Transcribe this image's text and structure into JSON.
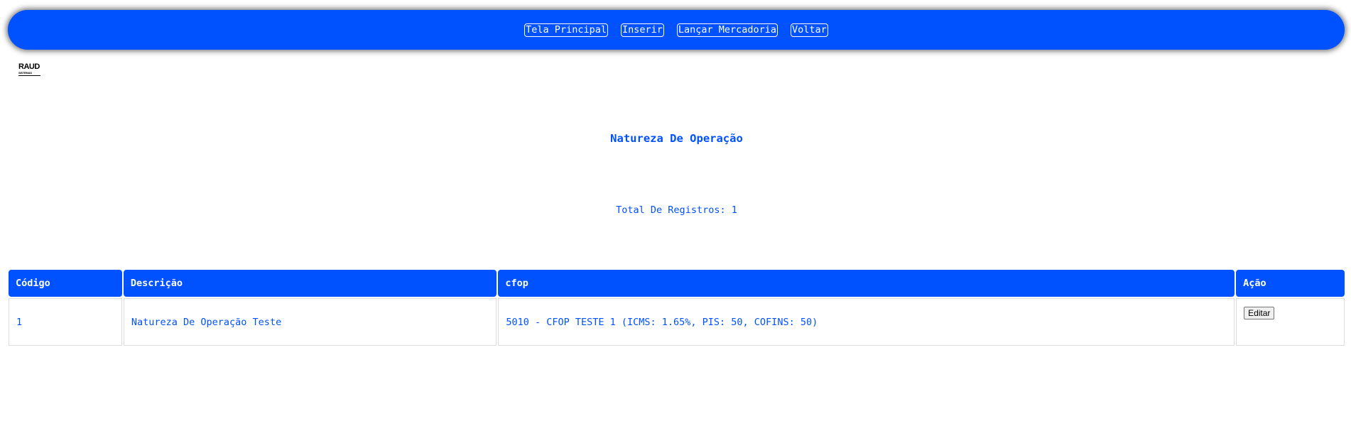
{
  "nav": {
    "buttons": [
      "Tela Principal",
      "Inserir",
      "Lançar Mercadoria",
      "Voltar"
    ]
  },
  "logo": {
    "main": "RAUD",
    "sub": "SISTEMAS"
  },
  "page": {
    "title": "Natureza De Operação",
    "total": "Total De Registros: 1"
  },
  "table": {
    "headers": [
      "Código",
      "Descrição",
      "cfop",
      "Ação"
    ],
    "rows": [
      {
        "codigo": "1",
        "descricao": "Natureza De Operação Teste",
        "cfop": "5010 - CFOP TESTE 1 (ICMS: 1.65%, PIS: 50, COFINS: 50)",
        "action_label": "Editar"
      }
    ]
  },
  "colors": {
    "primary": "#0051ff",
    "background": "#ffffff"
  }
}
